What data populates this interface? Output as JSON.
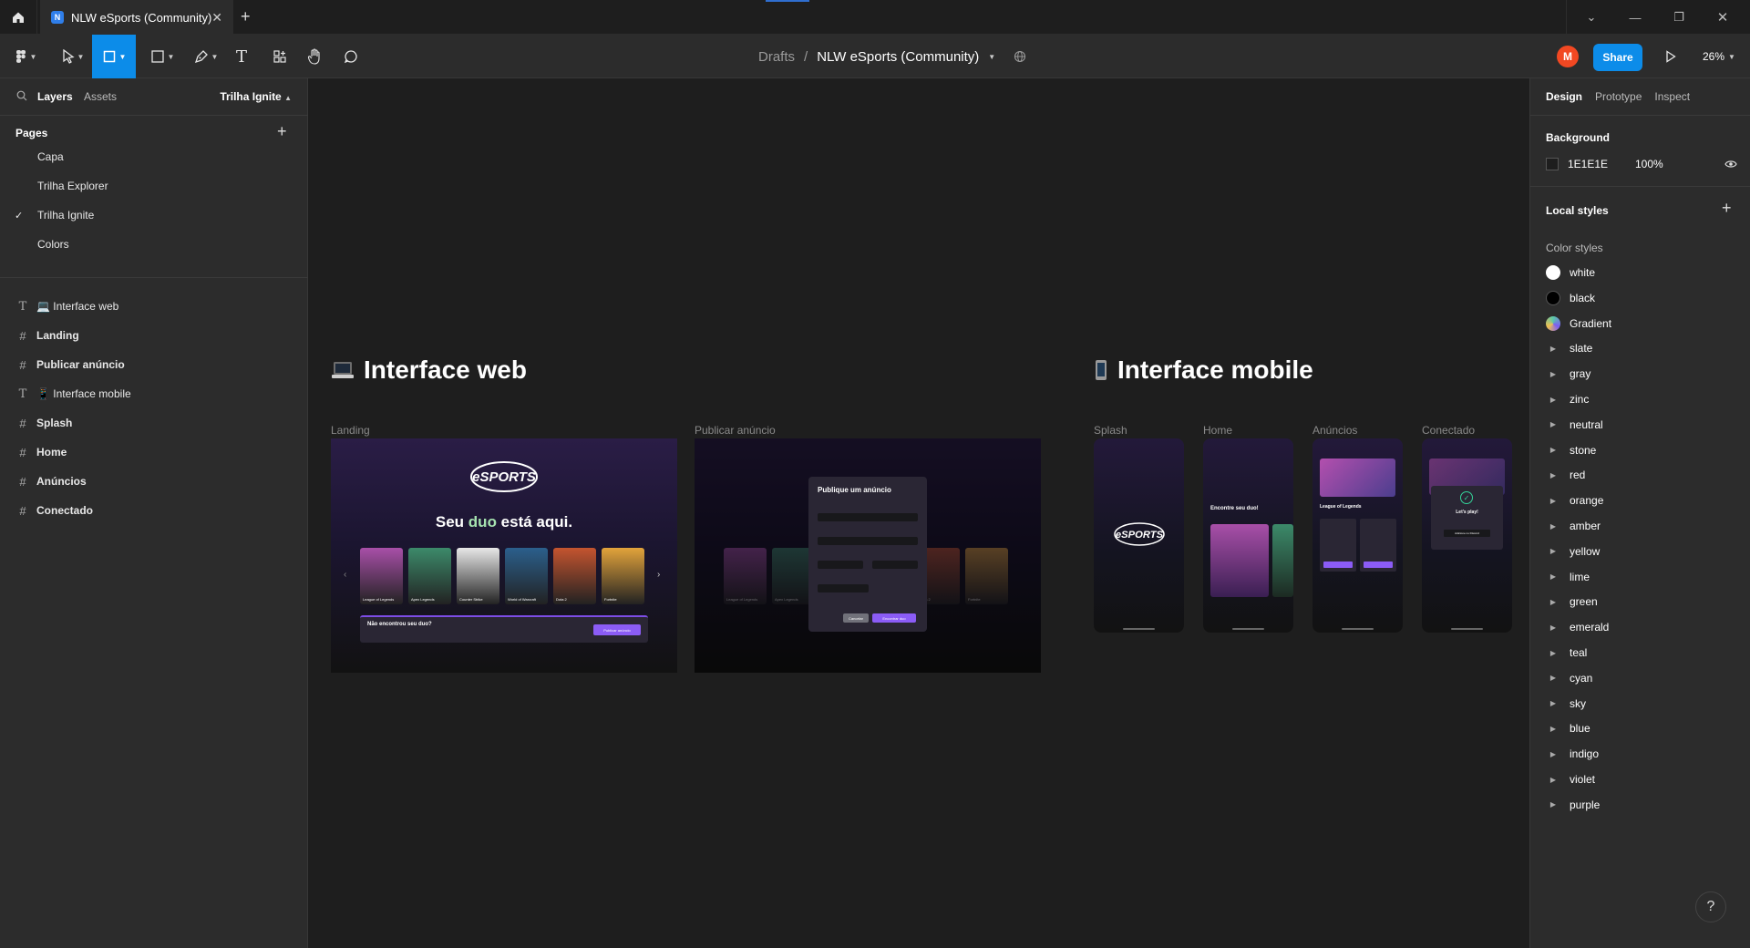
{
  "tabbar": {
    "file_tab": "NLW eSports (Community)",
    "file_tab_icon_letter": "N"
  },
  "toolbar": {
    "breadcrumb_parent": "Drafts",
    "breadcrumb_sep": "/",
    "file_name": "NLW eSports (Community)",
    "avatar_initial": "M",
    "share_label": "Share",
    "zoom": "26%"
  },
  "left_panel": {
    "tab_layers": "Layers",
    "tab_assets": "Assets",
    "current_page": "Trilha Ignite",
    "pages_heading": "Pages",
    "pages": [
      {
        "name": "Capa",
        "selected": false
      },
      {
        "name": "Trilha Explorer",
        "selected": false
      },
      {
        "name": "Trilha Ignite",
        "selected": true
      },
      {
        "name": "Colors",
        "selected": false
      }
    ],
    "layers": [
      {
        "type": "text",
        "name": "💻 Interface web"
      },
      {
        "type": "frame",
        "name": "Landing"
      },
      {
        "type": "frame",
        "name": "Publicar anúncio"
      },
      {
        "type": "text",
        "name": "📱 Interface mobile"
      },
      {
        "type": "frame",
        "name": "Splash"
      },
      {
        "type": "frame",
        "name": "Home"
      },
      {
        "type": "frame",
        "name": "Anúncios"
      },
      {
        "type": "frame",
        "name": "Conectado"
      }
    ]
  },
  "canvas": {
    "web_title": "Interface web",
    "mobile_title": "Interface mobile",
    "web_frames": [
      {
        "label": "Landing"
      },
      {
        "label": "Publicar anúncio"
      }
    ],
    "mobile_frames": [
      "Splash",
      "Home",
      "Anúncios",
      "Conectado"
    ],
    "logo_text": "eSPORTS",
    "hero_prefix": "Seu ",
    "hero_highlight": "duo",
    "hero_suffix": " está aqui.",
    "games": [
      "League of Legends",
      "Apex Legends",
      "Counter Strike",
      "World of Warcraft",
      "Dota 2",
      "Fortnite"
    ],
    "game_colors": [
      "#a84fa8",
      "#3c8a6a",
      "#e7e7e7",
      "#2b5f8c",
      "#c4542f",
      "#e2a33b"
    ],
    "cta_title": "Não encontrou seu duo?",
    "cta_button": "Publicar anúncio",
    "modal_title": "Publique um anúncio",
    "modal_cancel": "Cancelar",
    "modal_submit": "Encontrar duo",
    "mobile_home_title": "Encontre seu duo!",
    "mobile_lol": "League of Legends",
    "mobile_connected": "Let's play!",
    "mobile_discord_button": "Adicione no Discord"
  },
  "right_panel": {
    "tabs": [
      "Design",
      "Prototype",
      "Inspect"
    ],
    "background_heading": "Background",
    "bg_hex": "1E1E1E",
    "bg_opacity": "100%",
    "bg_color": "#1e1e1e",
    "local_styles": "Local styles",
    "color_styles": "Color styles",
    "styles": [
      {
        "name": "white",
        "kind": "swatch",
        "color": "#ffffff"
      },
      {
        "name": "black",
        "kind": "swatch",
        "color": "#000000"
      },
      {
        "name": "Gradient",
        "kind": "gradient",
        "color": "#5ac8a8"
      },
      {
        "name": "slate",
        "kind": "group"
      },
      {
        "name": "gray",
        "kind": "group"
      },
      {
        "name": "zinc",
        "kind": "group"
      },
      {
        "name": "neutral",
        "kind": "group"
      },
      {
        "name": "stone",
        "kind": "group"
      },
      {
        "name": "red",
        "kind": "group"
      },
      {
        "name": "orange",
        "kind": "group"
      },
      {
        "name": "amber",
        "kind": "group"
      },
      {
        "name": "yellow",
        "kind": "group"
      },
      {
        "name": "lime",
        "kind": "group"
      },
      {
        "name": "green",
        "kind": "group"
      },
      {
        "name": "emerald",
        "kind": "group"
      },
      {
        "name": "teal",
        "kind": "group"
      },
      {
        "name": "cyan",
        "kind": "group"
      },
      {
        "name": "sky",
        "kind": "group"
      },
      {
        "name": "blue",
        "kind": "group"
      },
      {
        "name": "indigo",
        "kind": "group"
      },
      {
        "name": "violet",
        "kind": "group"
      },
      {
        "name": "purple",
        "kind": "group"
      }
    ]
  },
  "help": "?"
}
